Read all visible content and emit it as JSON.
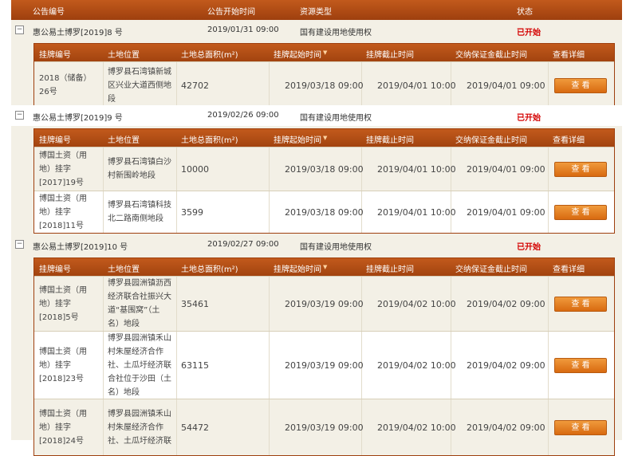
{
  "header": {
    "col1": "公告编号",
    "col2": "公告开始时间",
    "col3": "资源类型",
    "col4": "状态"
  },
  "sub_header": [
    "挂牌编号",
    "土地位置",
    "土地总面积(m²)",
    "挂牌起始时间",
    "挂牌截止时间",
    "交纳保证金截止时间",
    "查看详细"
  ],
  "announcements": [
    {
      "id": "惠公易土博罗[2019]8 号",
      "start": "2019/01/31 09:00",
      "type": "国有建设用地使用权",
      "status": "已开始",
      "lots": [
        {
          "code": [
            "2018（储备）",
            "26号"
          ],
          "location": [
            "博罗县石湾镇新城",
            "区兴业大道西侧地",
            "段"
          ],
          "area": "42702",
          "list_start": "2019/03/18 09:00",
          "list_end": "2019/04/01 10:00",
          "deposit_end": "2019/04/01 09:00",
          "button": "查 看"
        }
      ]
    },
    {
      "id": "惠公易土博罗[2019]9 号",
      "start": "2019/02/26 09:00",
      "type": "国有建设用地使用权",
      "status": "已开始",
      "lots": [
        {
          "code": [
            "博国土资（用",
            "地）挂字",
            "[2017]19号"
          ],
          "location": [
            "博罗县石湾镇白沙",
            "村新围岭地段"
          ],
          "area": "10000",
          "list_start": "2019/03/18 09:00",
          "list_end": "2019/04/01 10:00",
          "deposit_end": "2019/04/01 09:00",
          "button": "查 看"
        },
        {
          "code": [
            "博国土资（用",
            "地）挂字",
            "[2018]11号"
          ],
          "location": [
            "博罗县石湾镇科技",
            "北二路南侧地段"
          ],
          "area": "3599",
          "list_start": "2019/03/18 09:00",
          "list_end": "2019/04/01 10:00",
          "deposit_end": "2019/04/01 09:00",
          "button": "查 看"
        }
      ]
    },
    {
      "id": "惠公易土博罗[2019]10 号",
      "start": "2019/02/27 09:00",
      "type": "国有建设用地使用权",
      "status": "已开始",
      "lots": [
        {
          "code": [
            "博国土资（用",
            "地）挂字",
            "[2018]5号"
          ],
          "location": [
            "博罗县园洲镇沥西",
            "经济联合社振兴大",
            "道“基围窝”（土",
            "名）地段"
          ],
          "area": "35461",
          "list_start": "2019/03/19 09:00",
          "list_end": "2019/04/02 10:00",
          "deposit_end": "2019/04/02 09:00",
          "button": "查 看"
        },
        {
          "code": [
            "博国土资（用",
            "地）挂字",
            "[2018]23号"
          ],
          "location": [
            "博罗县园洲镇禾山",
            "村朱屋经济合作",
            "社、土瓜圩经济联",
            "合社位于沙田（土",
            "名）地段"
          ],
          "area": "63115",
          "list_start": "2019/03/19 09:00",
          "list_end": "2019/04/02 10:00",
          "deposit_end": "2019/04/02 09:00",
          "button": "查 看"
        },
        {
          "code": [
            "博国土资（用",
            "地）挂字",
            "[2018]24号"
          ],
          "location": [
            "博罗县园洲镇禾山",
            "村朱屋经济合作",
            "社、土瓜圩经济联"
          ],
          "area": "54472",
          "list_start": "2019/03/19 09:00",
          "list_end": "2019/04/02 10:00",
          "deposit_end": "2019/04/02 09:00",
          "button": "查 看"
        }
      ]
    }
  ]
}
